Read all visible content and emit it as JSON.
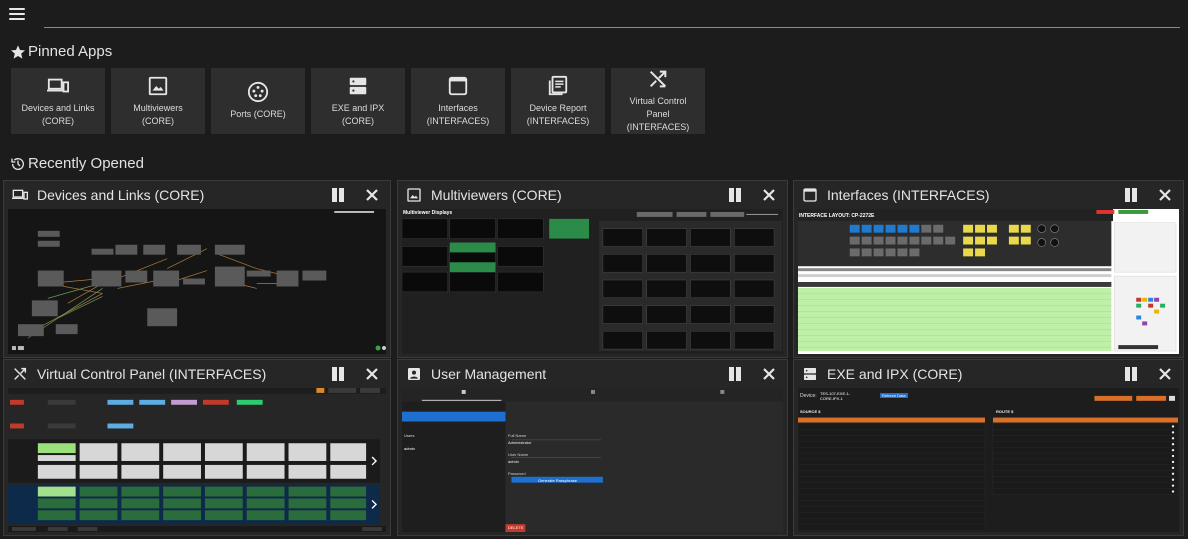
{
  "page": {
    "menu_icon": "hamburger-icon"
  },
  "pinned": {
    "title": "Pinned Apps",
    "icon": "star-icon",
    "items": [
      {
        "label": "Devices and Links\n(CORE)",
        "icon": "devices-icon"
      },
      {
        "label": "Multiviewers\n(CORE)",
        "icon": "image-icon"
      },
      {
        "label": "Ports (CORE)",
        "icon": "port-icon"
      },
      {
        "label": "EXE and IPX\n(CORE)",
        "icon": "server-icon"
      },
      {
        "label": "Interfaces\n(INTERFACES)",
        "icon": "window-icon"
      },
      {
        "label": "Device Report\n(INTERFACES)",
        "icon": "report-icon"
      },
      {
        "label": "Virtual Control\nPanel\n(INTERFACES)",
        "icon": "shuffle-icon"
      }
    ]
  },
  "recent": {
    "title": "Recently Opened",
    "icon": "history-icon",
    "panels": [
      {
        "title": "Devices and Links (CORE)",
        "icon": "devices-icon"
      },
      {
        "title": "Multiviewers (CORE)",
        "icon": "image-icon"
      },
      {
        "title": "Interfaces (INTERFACES)",
        "icon": "window-icon"
      },
      {
        "title": "Virtual Control Panel (INTERFACES)",
        "icon": "shuffle-icon"
      },
      {
        "title": "User Management",
        "icon": "user-badge-icon"
      },
      {
        "title": "EXE and IPX (CORE)",
        "icon": "server-icon"
      }
    ]
  },
  "thumbs": {
    "multiviewer_title": "Multiviewer Displays",
    "interfaces_layout": "INTERFACE LAYOUT: CP-2272E",
    "user_mgmt": {
      "users_label": "Users",
      "user_row": "admin",
      "full_name_label": "Full Name",
      "full_name": "Administrator",
      "username_label": "User Name",
      "username": "admin",
      "password_label": "Password",
      "password_button": "Generate Passphrase",
      "delete": "DELETE"
    },
    "exe": {
      "device_label": "Device:",
      "device_value": "TES-107-EXE-1-CORE-IPX-1",
      "refresh": "Refresh Data",
      "sources": "SOURCE $",
      "routes": "ROUTE $"
    }
  },
  "colors": {
    "background": "#1c1c1c",
    "tile": "#2e2e2e",
    "panel": "#262626",
    "accent_blue": "#1e6fd0",
    "accent_orange": "#d9702a",
    "accent_green": "#9be07a"
  }
}
